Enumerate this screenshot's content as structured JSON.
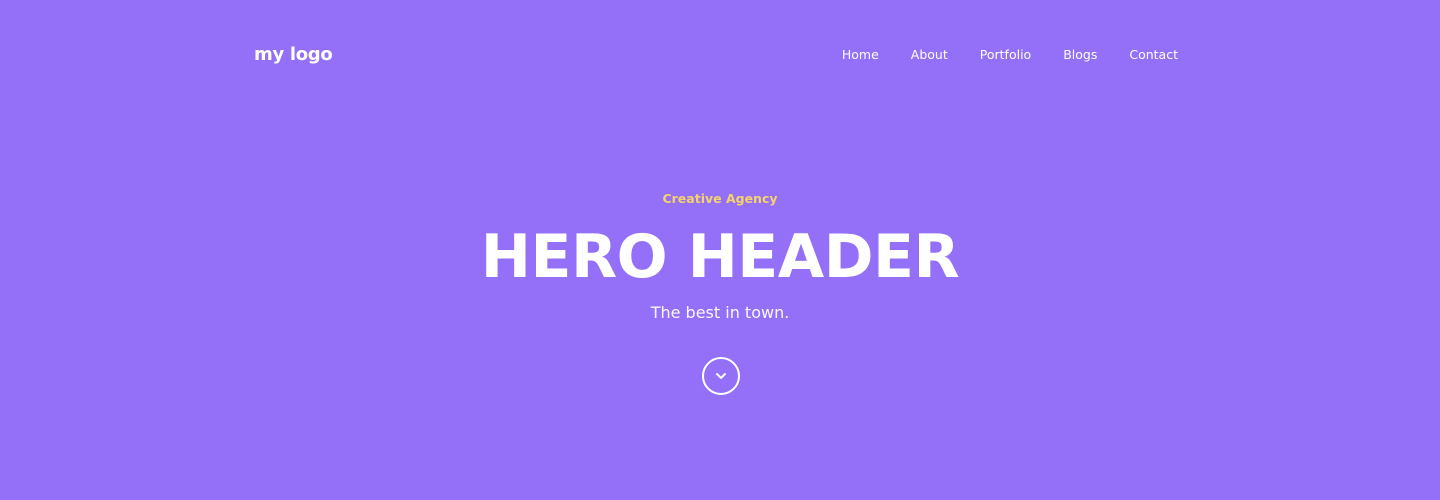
{
  "colors": {
    "background": "#9370F7",
    "accent": "#F6D26B",
    "text": "#FFFFFF"
  },
  "header": {
    "logo": "my logo",
    "nav": [
      {
        "label": "Home"
      },
      {
        "label": "About"
      },
      {
        "label": "Portfolio"
      },
      {
        "label": "Blogs"
      },
      {
        "label": "Contact"
      }
    ]
  },
  "hero": {
    "eyebrow": "Creative Agency",
    "title": "HERO HEADER",
    "subtitle": "The best in town.",
    "scroll_icon": "chevron-down-circle-icon"
  }
}
